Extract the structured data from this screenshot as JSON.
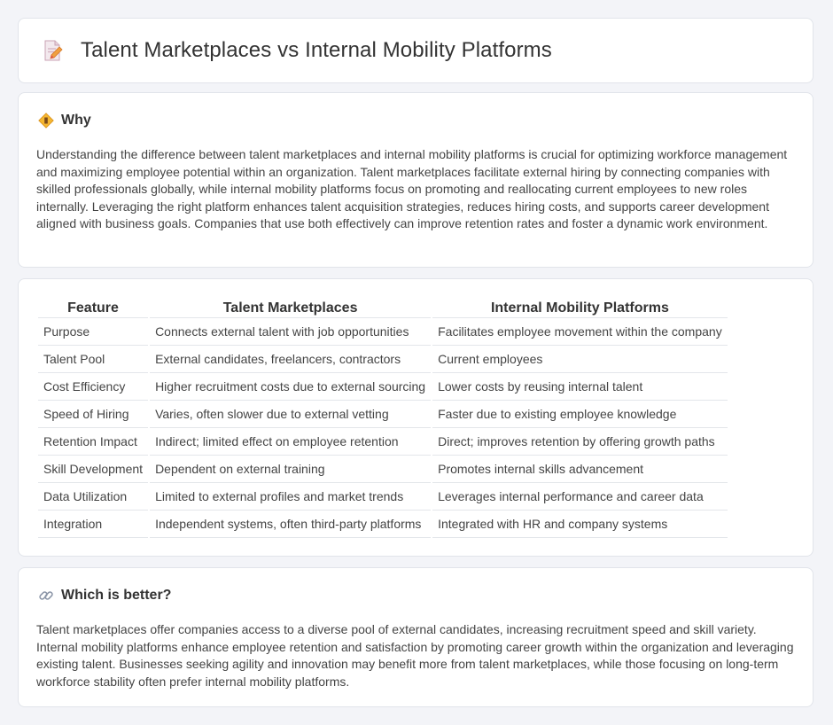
{
  "header": {
    "title": "Talent Marketplaces vs Internal Mobility Platforms",
    "icon": "document-pencil-icon"
  },
  "why": {
    "title": "Why",
    "icon": "diamond-warning-icon",
    "body": "Understanding the difference between talent marketplaces and internal mobility platforms is crucial for optimizing workforce management and maximizing employee potential within an organization. Talent marketplaces facilitate external hiring by connecting companies with skilled professionals globally, while internal mobility platforms focus on promoting and reallocating current employees to new roles internally. Leveraging the right platform enhances talent acquisition strategies, reduces hiring costs, and supports career development aligned with business goals. Companies that use both effectively can improve retention rates and foster a dynamic work environment."
  },
  "table": {
    "headers": [
      "Feature",
      "Talent Marketplaces",
      "Internal Mobility Platforms"
    ],
    "rows": [
      [
        "Purpose",
        "Connects external talent with job opportunities",
        "Facilitates employee movement within the company"
      ],
      [
        "Talent Pool",
        "External candidates, freelancers, contractors",
        "Current employees"
      ],
      [
        "Cost Efficiency",
        "Higher recruitment costs due to external sourcing",
        "Lower costs by reusing internal talent"
      ],
      [
        "Speed of Hiring",
        "Varies, often slower due to external vetting",
        "Faster due to existing employee knowledge"
      ],
      [
        "Retention Impact",
        "Indirect; limited effect on employee retention",
        "Direct; improves retention by offering growth paths"
      ],
      [
        "Skill Development",
        "Dependent on external training",
        "Promotes internal skills advancement"
      ],
      [
        "Data Utilization",
        "Limited to external profiles and market trends",
        "Leverages internal performance and career data"
      ],
      [
        "Integration",
        "Independent systems, often third-party platforms",
        "Integrated with HR and company systems"
      ]
    ]
  },
  "better": {
    "title": "Which is better?",
    "icon": "link-icon",
    "body": "Talent marketplaces offer companies access to a diverse pool of external candidates, increasing recruitment speed and skill variety. Internal mobility platforms enhance employee retention and satisfaction by promoting career growth within the organization and leveraging existing talent. Businesses seeking agility and innovation may benefit more from talent marketplaces, while those focusing on long-term workforce stability often prefer internal mobility platforms."
  }
}
